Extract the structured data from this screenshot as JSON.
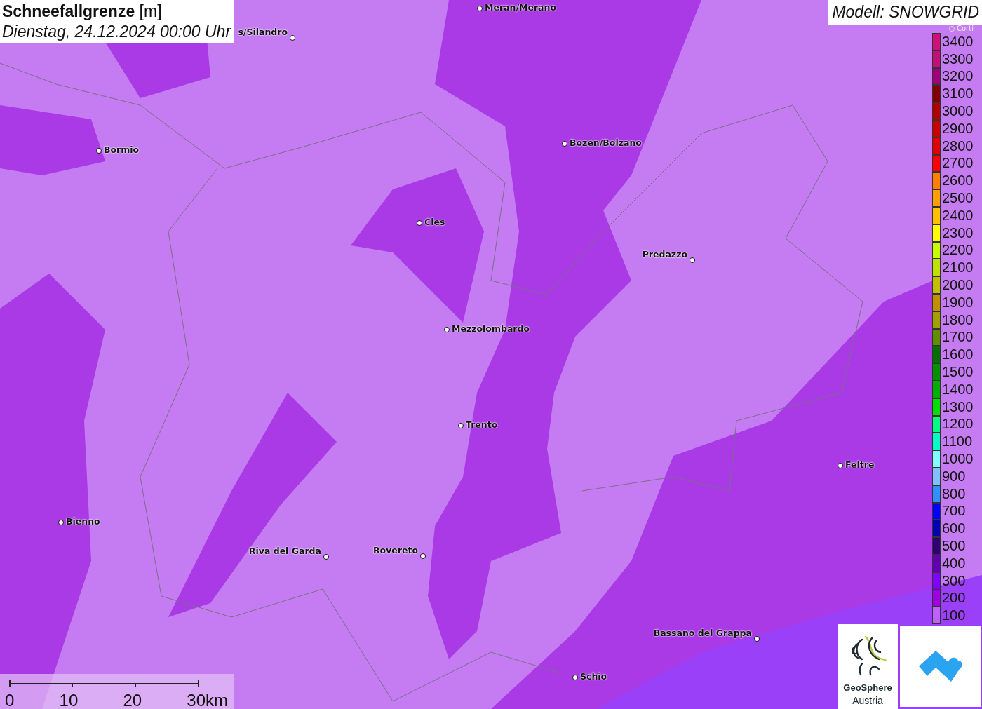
{
  "title": {
    "name": "Schneefallgrenze",
    "unit": "[m]",
    "date": "Dienstag, 24.12.2024 00:00 Uhr"
  },
  "model": "Modell: SNOWGRID",
  "legend": [
    {
      "label": "3400",
      "color": "#d0107a"
    },
    {
      "label": "3300",
      "color": "#c01078"
    },
    {
      "label": "3200",
      "color": "#a00078"
    },
    {
      "label": "3100",
      "color": "#800000"
    },
    {
      "label": "3000",
      "color": "#b00000"
    },
    {
      "label": "2900",
      "color": "#c80000"
    },
    {
      "label": "2800",
      "color": "#e00000"
    },
    {
      "label": "2700",
      "color": "#ff0000"
    },
    {
      "label": "2600",
      "color": "#ff8000"
    },
    {
      "label": "2500",
      "color": "#ffa000"
    },
    {
      "label": "2400",
      "color": "#ffc000"
    },
    {
      "label": "2300",
      "color": "#ffff00"
    },
    {
      "label": "2200",
      "color": "#c8ff00"
    },
    {
      "label": "2100",
      "color": "#c0e000"
    },
    {
      "label": "2000",
      "color": "#c0c000"
    },
    {
      "label": "1900",
      "color": "#c09000"
    },
    {
      "label": "1800",
      "color": "#a0a000"
    },
    {
      "label": "1700",
      "color": "#609000"
    },
    {
      "label": "1600",
      "color": "#007000"
    },
    {
      "label": "1500",
      "color": "#009000"
    },
    {
      "label": "1400",
      "color": "#00b000"
    },
    {
      "label": "1300",
      "color": "#00e000"
    },
    {
      "label": "1200",
      "color": "#00ff80"
    },
    {
      "label": "1100",
      "color": "#00ffc0"
    },
    {
      "label": "1000",
      "color": "#80ffff"
    },
    {
      "label": "900",
      "color": "#80c0ff"
    },
    {
      "label": "800",
      "color": "#3090ff"
    },
    {
      "label": "700",
      "color": "#0000ff"
    },
    {
      "label": "600",
      "color": "#0000b0"
    },
    {
      "label": "500",
      "color": "#300070"
    },
    {
      "label": "400",
      "color": "#6000b0"
    },
    {
      "label": "300",
      "color": "#8000ff"
    },
    {
      "label": "200",
      "color": "#a000e0"
    },
    {
      "label": "100",
      "color": "#c060ff"
    }
  ],
  "cities": [
    {
      "name": "Meran/Merano"
    },
    {
      "name": "s/Silandro"
    },
    {
      "name": "Bormio"
    },
    {
      "name": "Bozen/Bolzano"
    },
    {
      "name": "Cles"
    },
    {
      "name": "Predazzo"
    },
    {
      "name": "Mezzolombardo"
    },
    {
      "name": "Trento"
    },
    {
      "name": "Feltre"
    },
    {
      "name": "Bienno"
    },
    {
      "name": "Riva del Garda"
    },
    {
      "name": "Rovereto"
    },
    {
      "name": "Bassano del Grappa"
    },
    {
      "name": "Schio"
    },
    {
      "name": "Corti"
    }
  ],
  "scale": {
    "ticks": [
      "0",
      "10",
      "20",
      "30km"
    ]
  },
  "logo": {
    "line_1": "GeoSphere",
    "line_2": "Austria"
  }
}
